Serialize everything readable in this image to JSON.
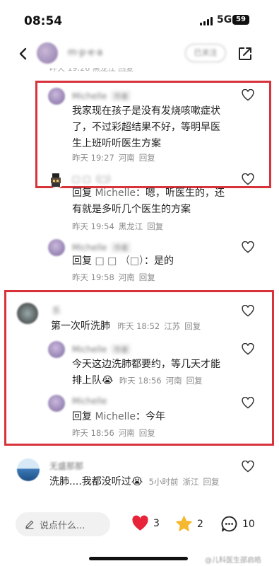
{
  "status_bar": {
    "time": "08:54",
    "network": "5G",
    "battery": "59"
  },
  "header": {
    "username": "m·p·e·a",
    "follow_label": "已关注"
  },
  "cutoff_line": "昨天 19:26 黑龙江 回复",
  "comments": [
    {
      "username": "Michelle",
      "badge": "作者",
      "text": "我家现在孩子是没有发烧咳嗽症状了，不过彩超结果不好，等明早医生上班听听医生方案",
      "time": "昨天 19:27",
      "location": "河南",
      "reply_label": "回复"
    },
    {
      "username": "□ □（□）",
      "reply_prefix": "回复",
      "mention": "Michelle",
      "text": "：嗯，听医生的，还有就是多听几个医生的方案",
      "time": "昨天 19:54",
      "location": "黑龙江",
      "reply_label": "回复"
    },
    {
      "username": "Michelle",
      "badge": "作者",
      "reply_prefix": "回复",
      "mention": "□ □ （□）",
      "text": "：是的",
      "time": "昨天 19:58",
      "location": "河南",
      "reply_label": "回复"
    },
    {
      "username": "乐",
      "text": "第一次听洗肺",
      "time": "昨天 18:52",
      "location": "江苏",
      "reply_label": "回复"
    },
    {
      "username": "Michelle",
      "badge": "作者",
      "text": "今天这边洗肺都要约，等几天才能排上队",
      "emoji": "😭",
      "time": "昨天 18:56",
      "location": "河南",
      "reply_label": "回复"
    },
    {
      "username": "Michelle",
      "reply_prefix": "回复",
      "mention": "Michelle",
      "text": "：今年",
      "time": "昨天 18:56",
      "location": "河南",
      "reply_label": "回复"
    },
    {
      "username": "无盛那那",
      "text": "洗肺....我都没听过",
      "emoji": "😭",
      "time": "5小时前",
      "location": "浙江",
      "reply_label": "回复"
    }
  ],
  "bottom_bar": {
    "input_placeholder": "说点什么...",
    "likes": "3",
    "collects": "2",
    "comments": "10"
  },
  "watermark": "@儿科医生邵启皓",
  "colors": {
    "highlight_box": "#d8323b",
    "like": "#e8243a",
    "collect": "#f5b82e"
  },
  "icons": [
    "back-icon",
    "share-icon",
    "heart-icon",
    "pencil-icon",
    "star-icon",
    "comment-icon"
  ]
}
